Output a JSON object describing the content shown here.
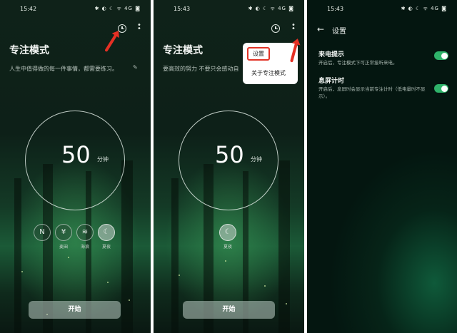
{
  "panel1": {
    "status_time": "15:42",
    "status_icons": "✱ ◐ ☾ ᯤ 4G ◙",
    "title": "专注模式",
    "subtitle": "人生中值得做的每一件事情，都需要练习。",
    "timer_value": "50",
    "timer_unit": "分钟",
    "sounds": [
      {
        "label": "",
        "icon": "N"
      },
      {
        "label": "麦田",
        "icon": "¥"
      },
      {
        "label": "海浪",
        "icon": "≋"
      },
      {
        "label": "夏夜",
        "icon": "☾"
      }
    ],
    "start_label": "开始"
  },
  "panel2": {
    "status_time": "15:43",
    "status_icons": "✱ ◐ ☾ ᯤ 4G ◙",
    "title": "专注模式",
    "subtitle": "要高效的努力 不要只会感动自",
    "timer_value": "50",
    "timer_unit": "分钟",
    "sound_label": "夏夜",
    "start_label": "开始",
    "menu": {
      "settings": "设置",
      "about": "关于专注模式"
    }
  },
  "panel3": {
    "status_time": "15:43",
    "status_icons": "✱ ◐ ☾ ᯤ 4G ◙",
    "title": "设置",
    "rows": [
      {
        "title": "来电提示",
        "desc": "开启后，专注模式下可正常接听来电。",
        "enabled": true
      },
      {
        "title": "息屏计时",
        "desc": "开启后，息屏时会显示当前专注计时（低电量时不显示）。",
        "enabled": true
      }
    ]
  },
  "colors": {
    "highlight_red": "#e53024",
    "toggle_green": "#2fb36a"
  }
}
